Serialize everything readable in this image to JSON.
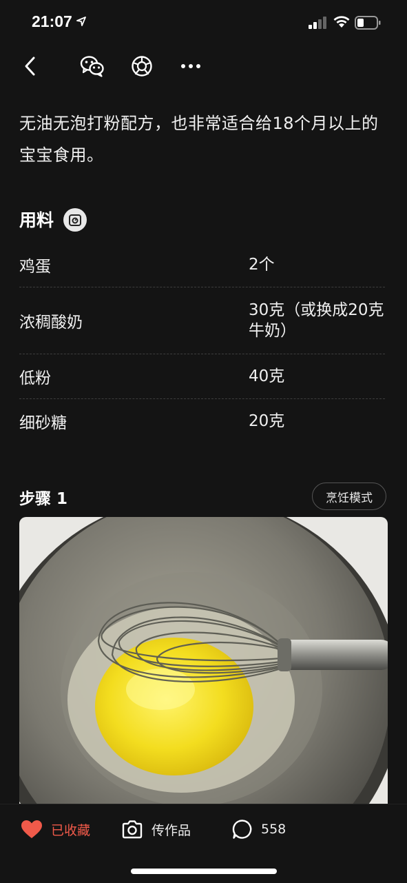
{
  "status_bar": {
    "time": "21:07"
  },
  "nav": {
    "back_icon": "chevron-left-icon",
    "wechat_icon": "wechat-icon",
    "moments_icon": "moments-icon",
    "more_icon": "more-dots-icon"
  },
  "recipe": {
    "intro": "无油无泡打粉配方，也非常适合给18个月以上的宝宝食用。",
    "ingredients_title": "用料",
    "ingredients": [
      {
        "name": "鸡蛋",
        "amount": "2个"
      },
      {
        "name": "浓稠酸奶",
        "amount": "30克（或换成20克牛奶）"
      },
      {
        "name": "低粉",
        "amount": "40克"
      },
      {
        "name": "细砂糖",
        "amount": "20克"
      }
    ],
    "step_title": "步骤 1",
    "cook_mode_label": "烹饪模式"
  },
  "bottom_bar": {
    "favorite_label": "已收藏",
    "upload_label": "传作品",
    "comment_count": "558"
  },
  "colors": {
    "background": "#141414",
    "accent": "#f05a4a",
    "text": "#f0f0f0"
  }
}
